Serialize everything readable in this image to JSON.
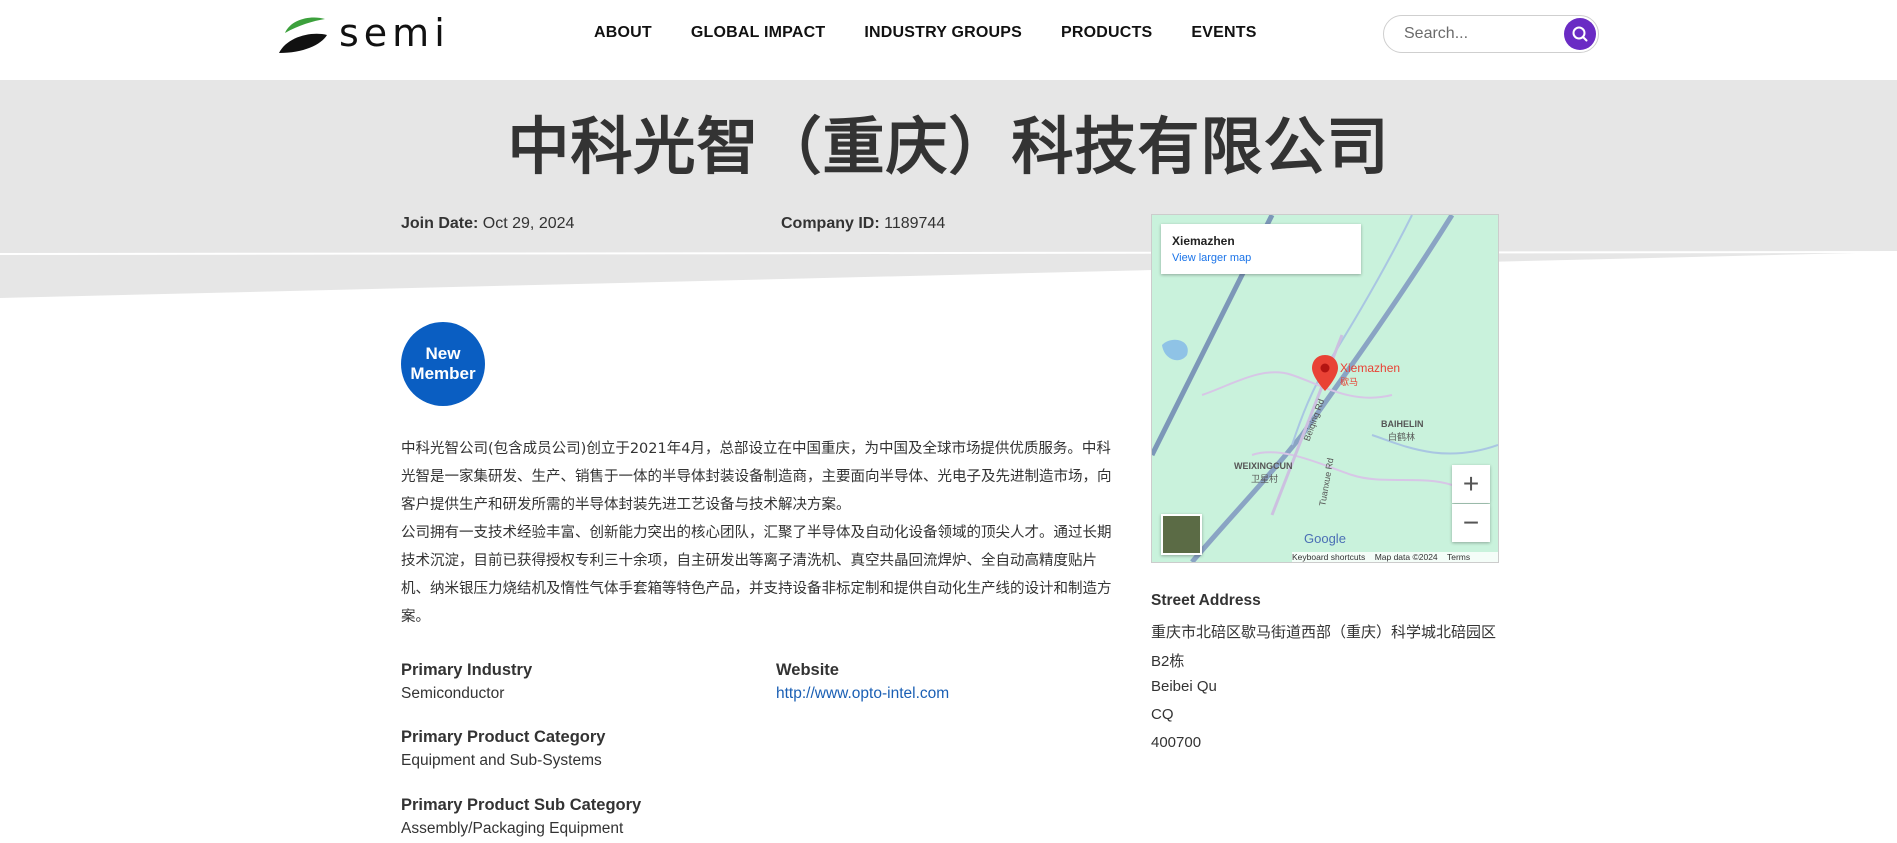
{
  "header": {
    "brand": "semi",
    "nav": [
      "ABOUT",
      "GLOBAL IMPACT",
      "INDUSTRY GROUPS",
      "PRODUCTS",
      "EVENTS"
    ],
    "search_placeholder": "Search..."
  },
  "company": {
    "name": "中科光智（重庆）科技有限公司",
    "join_date_label": "Join Date:",
    "join_date": "Oct 29, 2024",
    "company_id_label": "Company ID:",
    "company_id": "1189744",
    "badge_line1": "New",
    "badge_line2": "Member",
    "description": [
      "中科光智公司(包含成员公司)创立于2021年4月，总部设立在中国重庆，为中国及全球市场提供优质服务。中科光智是一家集研发、生产、销售于一体的半导体封装设备制造商，主要面向半导体、光电子及先进制造市场，向客户提供生产和研发所需的半导体封装先进工艺设备与技术解决方案。",
      "公司拥有一支技术经验丰富、创新能力突出的核心团队，汇聚了半导体及自动化设备领域的顶尖人才。通过长期技术沉淀，目前已获得授权专利三十余项，自主研发出等离子清洗机、真空共晶回流焊炉、全自动高精度贴片机、纳米银压力烧结机及惰性气体手套箱等特色产品，并支持设备非标定制和提供自动化生产线的设计和制造方案。"
    ],
    "primary_industry_label": "Primary Industry",
    "primary_industry": "Semiconductor",
    "website_label": "Website",
    "website": "http://www.opto-intel.com",
    "product_category_label": "Primary Product Category",
    "product_category": "Equipment and Sub-Systems",
    "product_subcategory_label": "Primary Product Sub Category",
    "product_subcategory": "Assembly/Packaging Equipment"
  },
  "map": {
    "place": "Xiemazhen",
    "larger_map_link": "View larger map",
    "pin_label": "Xiemazhen",
    "pin_label_cn": "歇马",
    "area_baihelin": "BAIHELIN",
    "area_baihelin_cn": "白鹤林",
    "area_weixingcun": "WEIXINGCUN",
    "area_weixingcun_cn": "卫星村",
    "road_beiqing": "Beiqing Rd",
    "road_tuanxue": "Tuanxue Rd",
    "zoom_in": "+",
    "zoom_out": "−",
    "google": "Google",
    "footer_shortcuts": "Keyboard shortcuts",
    "footer_data": "Map data ©2024",
    "footer_terms": "Terms"
  },
  "address": {
    "title": "Street Address",
    "lines": [
      "重庆市北碚区歇马街道西部（重庆）科学城北碚园区",
      "B2栋",
      "Beibei Qu",
      "CQ",
      "400700"
    ]
  },
  "colors": {
    "accent_purple": "#6a2bc4",
    "badge_blue": "#0a5ec2",
    "link_blue": "#1a5fb4",
    "band_gray": "#e6e6e6"
  }
}
